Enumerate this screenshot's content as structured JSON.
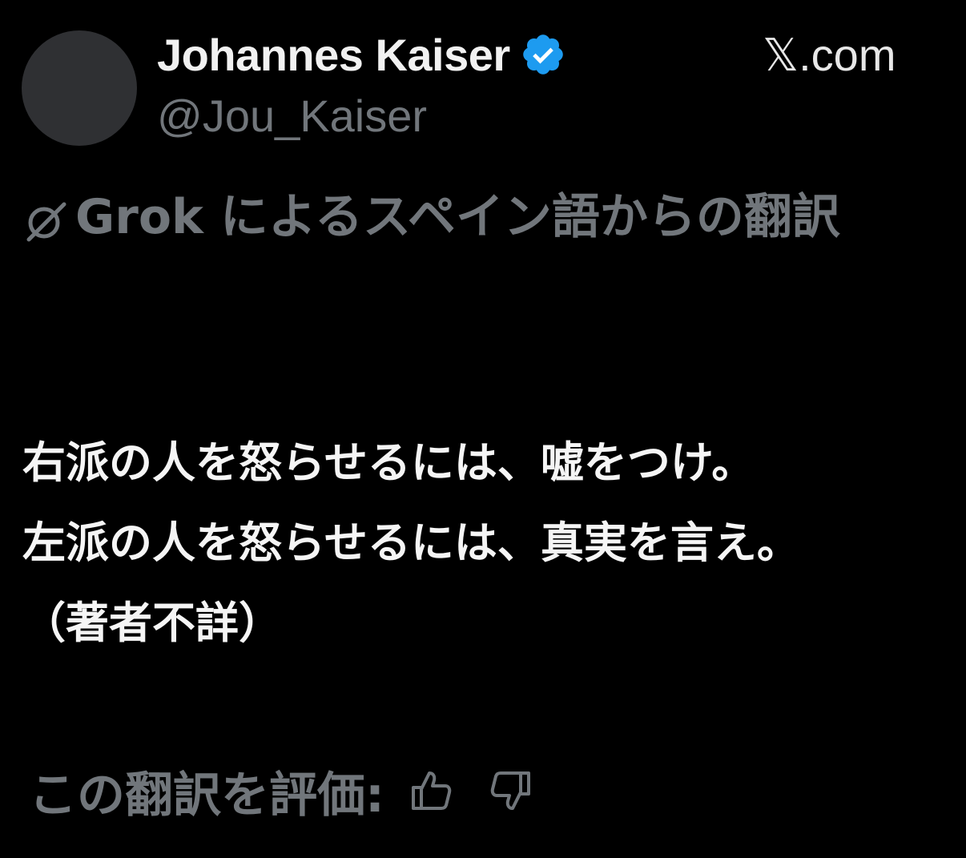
{
  "author": {
    "display_name": "Johannes Kaiser",
    "handle": "@Jou_Kaiser",
    "verified_icon": "verified-badge-icon",
    "avatar_color": "#2f3033"
  },
  "source": {
    "site": "𝕏.com"
  },
  "translation": {
    "icon": "grok-icon",
    "header": "Grok によるスペイン語からの翻訳"
  },
  "tweet": {
    "lines": [
      "右派の人を怒らせるには、嘘をつけ。",
      "左派の人を怒らせるには、真実を言え。",
      "（著者不詳）"
    ]
  },
  "rating": {
    "label": "この翻訳を評価:",
    "thumbs_up_icon": "thumbs-up-icon",
    "thumbs_down_icon": "thumbs-down-icon"
  },
  "colors": {
    "background": "#000000",
    "primary_text": "#e7e9ea",
    "secondary_text": "#71767b",
    "verified_blue": "#1d9bf0"
  }
}
